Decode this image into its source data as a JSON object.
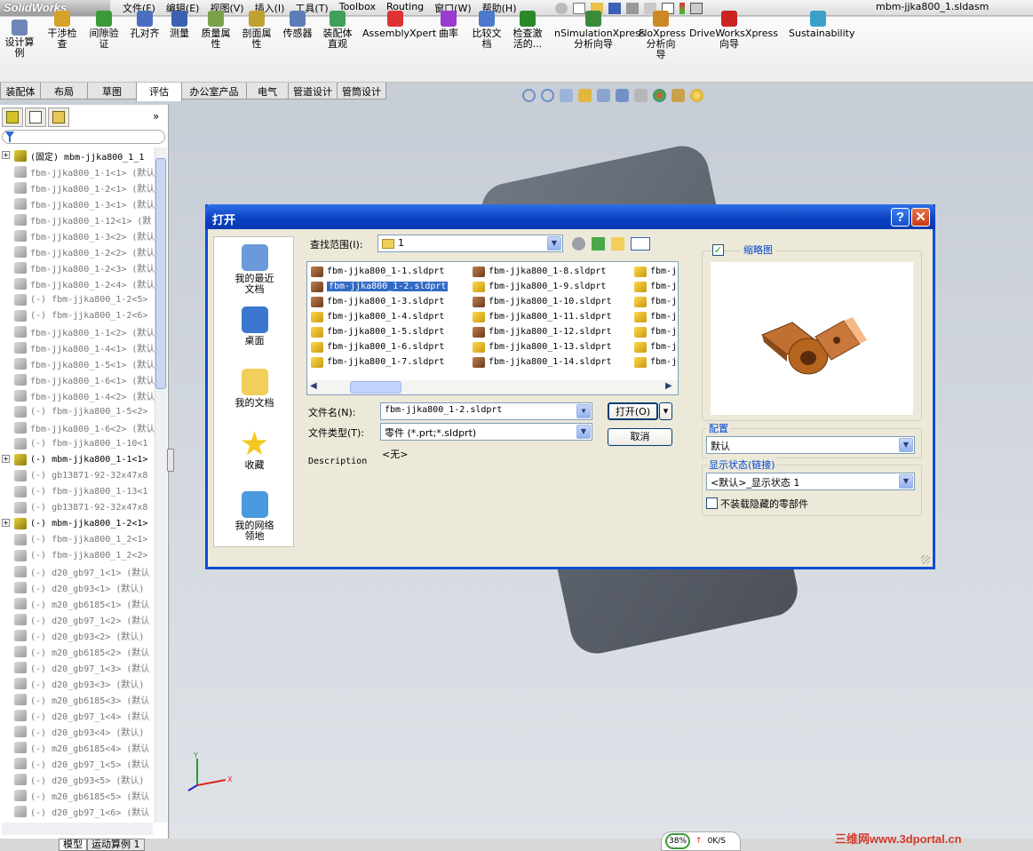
{
  "app": {
    "logo": "SolidWorks",
    "doc_title": "mbm-jjka800_1.sldasm",
    "menus": [
      "文件(F)",
      "编辑(E)",
      "视图(V)",
      "插入(I)",
      "工具(T)",
      "Toolbox",
      "Routing",
      "窗口(W)",
      "帮助(H)"
    ]
  },
  "ribbon": {
    "buttons": [
      {
        "label": "设计算\n例",
        "icon": "design-study-icon"
      },
      {
        "label": "干涉检\n查",
        "icon": "interference-icon"
      },
      {
        "label": "间隙验\n证",
        "icon": "clearance-icon"
      },
      {
        "label": "孔对齐",
        "icon": "hole-align-icon"
      },
      {
        "label": "测量",
        "icon": "measure-icon"
      },
      {
        "label": "质量属\n性",
        "icon": "mass-props-icon"
      },
      {
        "label": "剖面属\n性",
        "icon": "section-props-icon"
      },
      {
        "label": "传感器",
        "icon": "sensor-icon"
      },
      {
        "label": "装配体\n直观",
        "icon": "assembly-visual-icon"
      },
      {
        "label": "AssemblyXpert",
        "icon": "assemblyxpert-icon"
      },
      {
        "label": "曲率",
        "icon": "curvature-icon"
      },
      {
        "label": "比较文\n档",
        "icon": "compare-icon"
      },
      {
        "label": "检查激\n活的...",
        "icon": "check-icon"
      },
      {
        "label": "nSimulationXpress\n分析向导",
        "icon": "simxpress-icon"
      },
      {
        "label": "FloXpress\n分析向\n导",
        "icon": "floxpress-icon"
      },
      {
        "label": "DriveWorksXpress\n向导",
        "icon": "driveworks-icon"
      },
      {
        "label": "Sustainability",
        "icon": "sustainability-icon"
      }
    ]
  },
  "command_tabs": [
    "装配体",
    "布局",
    "草图",
    "评估",
    "办公室产品",
    "电气",
    "管道设计",
    "管筒设计"
  ],
  "active_command_tab": "评估",
  "tree": {
    "root": "(固定) mbm-jjka800_1_1",
    "items": [
      {
        "text": "fbm-jjka800_1-1<1> (默认",
        "bold": false
      },
      {
        "text": "fbm-jjka800_1-2<1> (默认",
        "bold": false
      },
      {
        "text": "fbm-jjka800_1-3<1> (默认",
        "bold": false
      },
      {
        "text": "fbm-jjka800_1-12<1> (默",
        "bold": false
      },
      {
        "text": "fbm-jjka800_1-3<2> (默认",
        "bold": false
      },
      {
        "text": "fbm-jjka800_1-2<2> (默认",
        "bold": false
      },
      {
        "text": "fbm-jjka800_1-2<3> (默认",
        "bold": false
      },
      {
        "text": "fbm-jjka800_1-2<4> (默认",
        "bold": false
      },
      {
        "text": "(-) fbm-jjka800_1-2<5>",
        "bold": false
      },
      {
        "text": "(-) fbm-jjka800_1-2<6>",
        "bold": false
      },
      {
        "text": "fbm-jjka800_1-1<2> (默认",
        "bold": false
      },
      {
        "text": "fbm-jjka800_1-4<1> (默认",
        "bold": false
      },
      {
        "text": "fbm-jjka800_1-5<1> (默认",
        "bold": false
      },
      {
        "text": "fbm-jjka800_1-6<1> (默认",
        "bold": false
      },
      {
        "text": "fbm-jjka800_1-4<2> (默认",
        "bold": false
      },
      {
        "text": "(-) fbm-jjka800_1-5<2>",
        "bold": false
      },
      {
        "text": "fbm-jjka800_1-6<2> (默认",
        "bold": false
      },
      {
        "text": "(-) fbm-jjka800_1-10<1",
        "bold": false
      },
      {
        "text": "(-) mbm-jjka800_1-1<1>",
        "bold": true
      },
      {
        "text": "(-) gb13871-92-32x47x8",
        "bold": false
      },
      {
        "text": "(-) fbm-jjka800_1-13<1",
        "bold": false
      },
      {
        "text": "(-) gb13871-92-32x47x8",
        "bold": false
      },
      {
        "text": "(-) mbm-jjka800_1-2<1>",
        "bold": true
      },
      {
        "text": "(-) fbm-jjka800_1_2<1>",
        "bold": false
      },
      {
        "text": "(-) fbm-jjka800_1_2<2>",
        "bold": false
      },
      {
        "text": "(-) d20_gb97_1<1> (默认",
        "bold": false
      },
      {
        "text": "(-) d20_gb93<1> (默认)",
        "bold": false
      },
      {
        "text": "(-) m20_gb6185<1> (默认",
        "bold": false
      },
      {
        "text": "(-) d20_gb97_1<2> (默认",
        "bold": false
      },
      {
        "text": "(-) d20_gb93<2> (默认)",
        "bold": false
      },
      {
        "text": "(-) m20_gb6185<2> (默认",
        "bold": false
      },
      {
        "text": "(-) d20_gb97_1<3> (默认",
        "bold": false
      },
      {
        "text": "(-) d20_gb93<3> (默认)",
        "bold": false
      },
      {
        "text": "(-) m20_gb6185<3> (默认",
        "bold": false
      },
      {
        "text": "(-) d20_gb97_1<4> (默认",
        "bold": false
      },
      {
        "text": "(-) d20_gb93<4> (默认)",
        "bold": false
      },
      {
        "text": "(-) m20_gb6185<4> (默认",
        "bold": false
      },
      {
        "text": "(-) d20_gb97_1<5> (默认",
        "bold": false
      },
      {
        "text": "(-) d20_gb93<5> (默认)",
        "bold": false
      },
      {
        "text": "(-) m20_gb6185<5> (默认",
        "bold": false
      },
      {
        "text": "(-) d20_gb97_1<6> (默认",
        "bold": false
      }
    ]
  },
  "bottom_tabs": [
    "模型",
    "运动算例 1"
  ],
  "status": {
    "percent": "38%",
    "speed": "0K/S"
  },
  "watermark": "三维网www.3dportal.cn",
  "dialog": {
    "title": "打开",
    "help": "?",
    "close": "✕",
    "look_in_label": "查找范围(I):",
    "look_in_value": "1",
    "places": [
      "我的最近\n文档",
      "桌面",
      "我的文档",
      "收藏",
      "我的网络\n领地"
    ],
    "files_col1": [
      "fbm-jjka800_1-1.sldprt",
      "fbm-jjka800_1-2.sldprt",
      "fbm-jjka800_1-3.sldprt",
      "fbm-jjka800_1-4.sldprt",
      "fbm-jjka800_1-5.sldprt",
      "fbm-jjka800_1-6.sldprt",
      "fbm-jjka800_1-7.sldprt"
    ],
    "files_col2": [
      "fbm-jjka800_1-8.sldprt",
      "fbm-jjka800_1-9.sldprt",
      "fbm-jjka800_1-10.sldprt",
      "fbm-jjka800_1-11.sldprt",
      "fbm-jjka800_1-12.sldprt",
      "fbm-jjka800_1-13.sldprt",
      "fbm-jjka800_1-14.sldprt"
    ],
    "files_col3": [
      "fbm-j",
      "fbm-j",
      "fbm-j",
      "fbm-j",
      "fbm-j",
      "fbm-j",
      "fbm-j"
    ],
    "selected_file": "fbm-jjka800_1-2.sldprt",
    "filename_label": "文件名(N):",
    "filename_value": "fbm-jjka800_1-2.sldprt",
    "filetype_label": "文件类型(T):",
    "filetype_value": "零件 (*.prt;*.sldprt)",
    "description_label": "Description",
    "description_value": "<无>",
    "open_button": "打开(O)",
    "cancel_button": "取消",
    "thumbnail_label": "缩略图",
    "thumbnail_checked": true,
    "config_label": "配置",
    "config_value": "默认",
    "display_state_label": "显示状态(链接)",
    "display_state_value": "<默认>_显示状态 1",
    "no_hidden_label": "不装载隐藏的零部件",
    "no_hidden_checked": false
  },
  "colors": {
    "title_blue": "#0a4ed0",
    "selection": "#316ac5",
    "dialog_bg": "#ece9d8",
    "part_copper": "#b5651d"
  }
}
